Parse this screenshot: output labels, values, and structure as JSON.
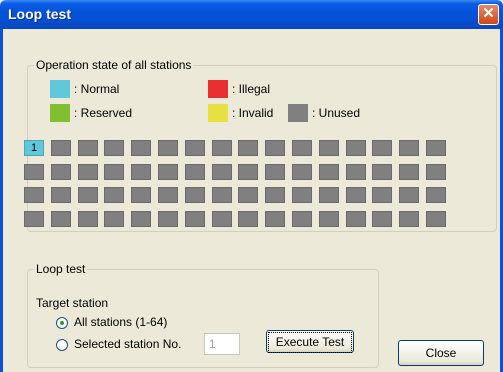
{
  "window": {
    "title": "Loop test",
    "close_glyph": "✕"
  },
  "operation_state": {
    "legend_title": "Operation state of all stations",
    "legend": [
      {
        "label": ": Normal",
        "color": "#60c8d8"
      },
      {
        "label": ": Illegal",
        "color": "#e83030"
      },
      {
        "label": ": Reserved",
        "color": "#80c030"
      },
      {
        "label": ": Invalid",
        "color": "#e8e040"
      },
      {
        "label": ": Unused",
        "color": "#808080"
      }
    ],
    "stations": {
      "count": 64,
      "per_row": 16,
      "normal_station": "1",
      "unused_color": "#808080"
    }
  },
  "loop_test": {
    "group_title": "Loop test",
    "target_label": "Target station",
    "option_all": "All stations (1-64)",
    "option_selected": "Selected station No.",
    "selected_value": "all",
    "station_no": "1",
    "execute_label": "Execute Test"
  },
  "close_label": "Close"
}
